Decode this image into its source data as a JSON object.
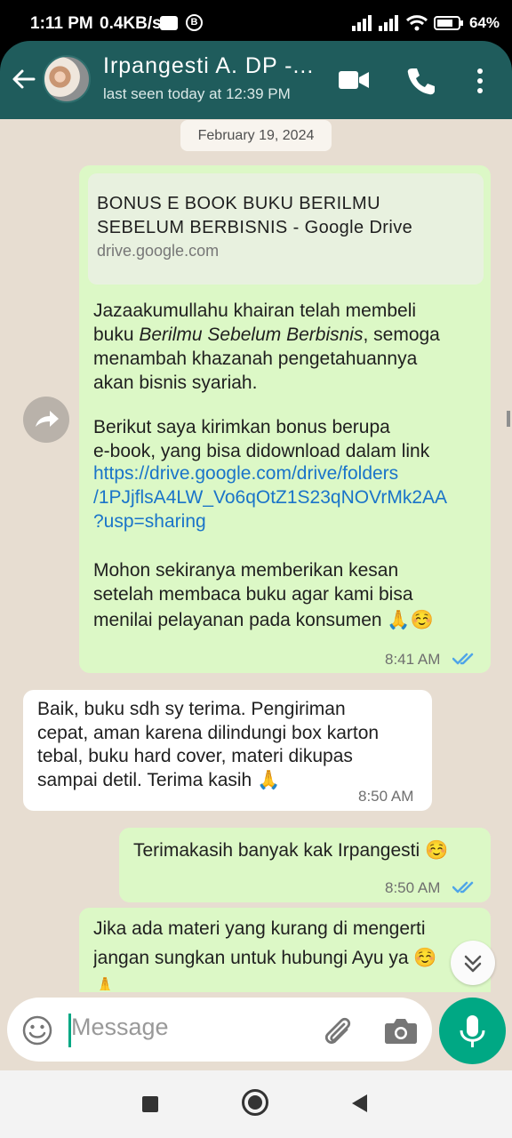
{
  "status_bar": {
    "time": "1:11 PM",
    "speed": "0.4KB/s",
    "badge": "B",
    "battery": "64"
  },
  "header": {
    "contact_name": "Irpangesti A. DP -...",
    "last_seen": "last seen today at 12:39 PM",
    "icons": [
      "back-arrow-icon",
      "video-call-icon",
      "phone-icon",
      "more-options-icon"
    ]
  },
  "date_chip": "February 19, 2024",
  "messages": [
    {
      "direction": "outgoing",
      "link_preview": {
        "title_line1": "BONUS E BOOK BUKU BERILMU",
        "title_line2": "SEBELUM BERBISNIS - Google Drive",
        "domain": "drive.google.com"
      },
      "lines": [
        "Jazaakumullahu khairan telah membeli",
        "buku ",
        "Berilmu Sebelum Berbisnis",
        ", semoga",
        "menambah khazanah pengetahuannya",
        "akan bisnis syariah.",
        "Berikut saya kirimkan bonus berupa",
        "e-book, yang bisa didownload dalam link",
        "https://drive.google.com/drive/folders",
        "/1PJjflsA4LW_Vo6qOtZ1S23qNOVrMk2AA",
        "?usp=sharing",
        "Mohon sekiranya memberikan kesan",
        "setelah membaca buku agar kami bisa",
        "menilai pelayanan pada konsumen 🙏☺️"
      ],
      "time": "8:41 AM",
      "status": "read"
    },
    {
      "direction": "incoming",
      "lines": [
        "Baik, buku sdh sy terima.  Pengiriman",
        "cepat, aman karena dilindungi box karton",
        "tebal, buku hard cover,  materi dikupas",
        "sampai detil. Terima kasih 🙏"
      ],
      "time": "8:50 AM"
    },
    {
      "direction": "outgoing",
      "lines": [
        "Terimakasih banyak kak Irpangesti ☺️"
      ],
      "time": "8:50 AM",
      "status": "read"
    },
    {
      "direction": "outgoing",
      "lines": [
        "Jika ada materi yang kurang di mengerti",
        "jangan sungkan untuk hubungi Ayu ya ☺️",
        "🙏"
      ]
    }
  ],
  "composer": {
    "placeholder": "Message"
  },
  "colors": {
    "header": "#1f5c5c",
    "chat_background": "#e7ddd1",
    "outgoing_bubble": "#dcf8c6",
    "incoming_bubble": "#ffffff",
    "accent": "#00a884",
    "link": "#1a74c9",
    "read_tick": "#4fa5e8"
  }
}
